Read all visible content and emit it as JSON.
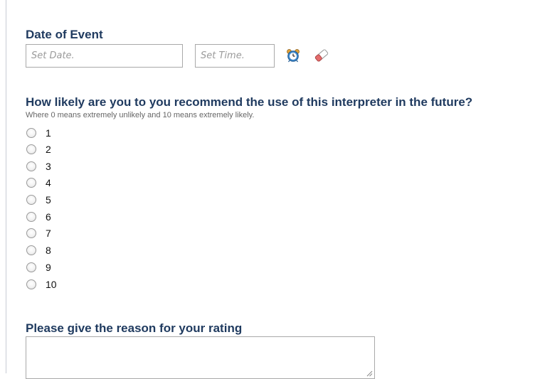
{
  "date_section": {
    "title": "Date of Event",
    "date_placeholder": "Set Date.",
    "time_placeholder": "Set Time.",
    "icons": [
      "alarm-clock-icon",
      "eraser-icon"
    ]
  },
  "rating_question": {
    "title": "How likely are you to you recommend the use of this interpreter in the future?",
    "help": "Where 0 means extremely unlikely and 10 means extremely likely.",
    "options": [
      "1",
      "2",
      "3",
      "4",
      "5",
      "6",
      "7",
      "8",
      "9",
      "10"
    ],
    "selected": null
  },
  "reason_section": {
    "title": "Please give the reason for your rating",
    "value": ""
  },
  "colors": {
    "label": "#1f3a5f",
    "help_text": "#666666",
    "border": "#a9a9a9"
  }
}
